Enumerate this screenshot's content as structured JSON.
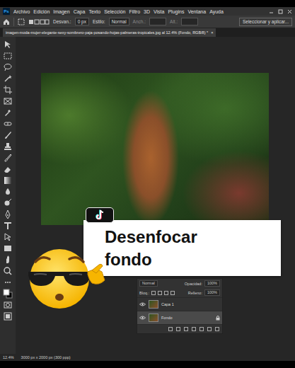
{
  "app": {
    "logo": "Ps"
  },
  "menu": [
    "Archivo",
    "Edición",
    "Imagen",
    "Capa",
    "Texto",
    "Selección",
    "Filtro",
    "3D",
    "Vista",
    "Plugins",
    "Ventana",
    "Ayuda"
  ],
  "options_bar": {
    "feather_label": "Desvan.:",
    "feather": "0 px",
    "style_label": "Estilo:",
    "style": "Normal",
    "width_label": "Anch.:",
    "height_label": "Alt.:",
    "select_mask": "Seleccionar y aplicar..."
  },
  "document_tab": {
    "title": "imagen-moda-mujer-elegante-sexy-sombrero-paja-posando-hojas-palmeras-tropicales.jpg al 12.4% (Fondo, RGB/8) *",
    "close": "×"
  },
  "caption": {
    "lines": [
      "Desenfocar",
      "fondo"
    ]
  },
  "layers_panel": {
    "blend_mode": "Normal",
    "opacity_label": "Opacidad:",
    "opacity": "100%",
    "lock_label": "Bloq.:",
    "fill_label": "Relleno:",
    "fill": "100%",
    "layers": [
      {
        "name": "Capa 1",
        "visible": true,
        "selected": false,
        "locked": false
      },
      {
        "name": "Fondo",
        "visible": true,
        "selected": true,
        "locked": true
      }
    ]
  },
  "status_bar": {
    "zoom": "12.4%",
    "info": "3000 px x 2000 px (300 ppp)"
  }
}
